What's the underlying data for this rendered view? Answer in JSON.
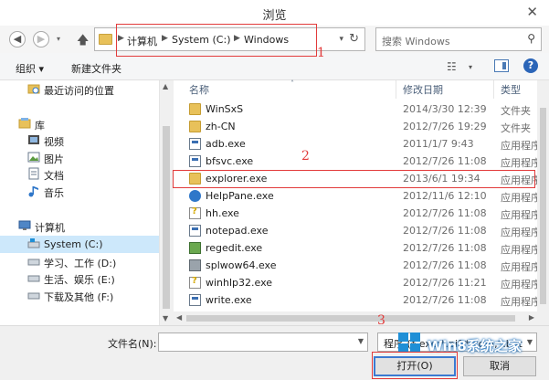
{
  "window": {
    "title": "浏览",
    "close_glyph": "✕"
  },
  "nav": {
    "back_glyph": "◀",
    "forward_glyph": "▶",
    "recent_glyph": "▾",
    "up_icon": "up-arrow-icon"
  },
  "address": {
    "crumbs": [
      "计算机",
      "System (C:)",
      "Windows"
    ],
    "sep": "▶",
    "dropdown_glyph": "▾",
    "refresh_glyph": "↻"
  },
  "search": {
    "placeholder": "搜索 Windows",
    "icon_glyph": "⚲"
  },
  "toolbar": {
    "organize": "组织 ▾",
    "new_folder": "新建文件夹",
    "view_glyph": "☷",
    "view_caret": "▾",
    "help_glyph": "?"
  },
  "navpane": {
    "items": [
      {
        "label": "最近访问的位置",
        "icon": "recent-places-icon"
      },
      {
        "label": "库",
        "icon": "library-icon"
      },
      {
        "label": "视频",
        "icon": "video-icon"
      },
      {
        "label": "图片",
        "icon": "pictures-icon"
      },
      {
        "label": "文档",
        "icon": "documents-icon"
      },
      {
        "label": "音乐",
        "icon": "music-icon"
      },
      {
        "label": "计算机",
        "icon": "computer-icon"
      },
      {
        "label": "System (C:)",
        "icon": "drive-icon",
        "selected": true
      },
      {
        "label": "学习、工作 (D:)",
        "icon": "drive-icon"
      },
      {
        "label": "生活、娱乐 (E:)",
        "icon": "drive-icon"
      },
      {
        "label": "下载及其他 (F:)",
        "icon": "drive-icon"
      }
    ]
  },
  "columns": {
    "name": "名称",
    "date": "修改日期",
    "type": "类型",
    "sort_glyph": "˄"
  },
  "files": [
    {
      "name": "WinSxS",
      "date": "2014/3/30 12:39",
      "type": "文件夹",
      "icon": "folder"
    },
    {
      "name": "zh-CN",
      "date": "2012/7/26 19:29",
      "type": "文件夹",
      "icon": "folder"
    },
    {
      "name": "adb.exe",
      "date": "2011/1/7 9:43",
      "type": "应用程序",
      "icon": "exe"
    },
    {
      "name": "bfsvc.exe",
      "date": "2012/7/26 11:08",
      "type": "应用程序",
      "icon": "exe"
    },
    {
      "name": "explorer.exe",
      "date": "2013/6/1 19:34",
      "type": "应用程序",
      "icon": "folder"
    },
    {
      "name": "HelpPane.exe",
      "date": "2012/11/6 12:10",
      "type": "应用程序",
      "icon": "help"
    },
    {
      "name": "hh.exe",
      "date": "2012/7/26 11:08",
      "type": "应用程序",
      "icon": "doc"
    },
    {
      "name": "notepad.exe",
      "date": "2012/7/26 11:08",
      "type": "应用程序",
      "icon": "exe"
    },
    {
      "name": "regedit.exe",
      "date": "2012/7/26 11:08",
      "type": "应用程序",
      "icon": "reg"
    },
    {
      "name": "splwow64.exe",
      "date": "2012/7/26 11:08",
      "type": "应用程序",
      "icon": "print"
    },
    {
      "name": "winhlp32.exe",
      "date": "2012/7/26 11:21",
      "type": "应用程序",
      "icon": "doc"
    },
    {
      "name": "write.exe",
      "date": "2012/7/26 11:08",
      "type": "应用程序",
      "icon": "exe"
    }
  ],
  "bottom": {
    "filename_label": "文件名(N):",
    "filename_value": "",
    "filter_text": "程序 (*.exe;*.pif;*.com;*.bat",
    "open_button": "打开(O)",
    "cancel_button": "取消"
  },
  "watermark": {
    "text": "Win8系统之家"
  },
  "annotations": [
    "1",
    "2",
    "3"
  ],
  "colors": {
    "accent": "#3b7ad1",
    "annotation": "#e23b3b",
    "selected_bg": "#cde8fb"
  }
}
